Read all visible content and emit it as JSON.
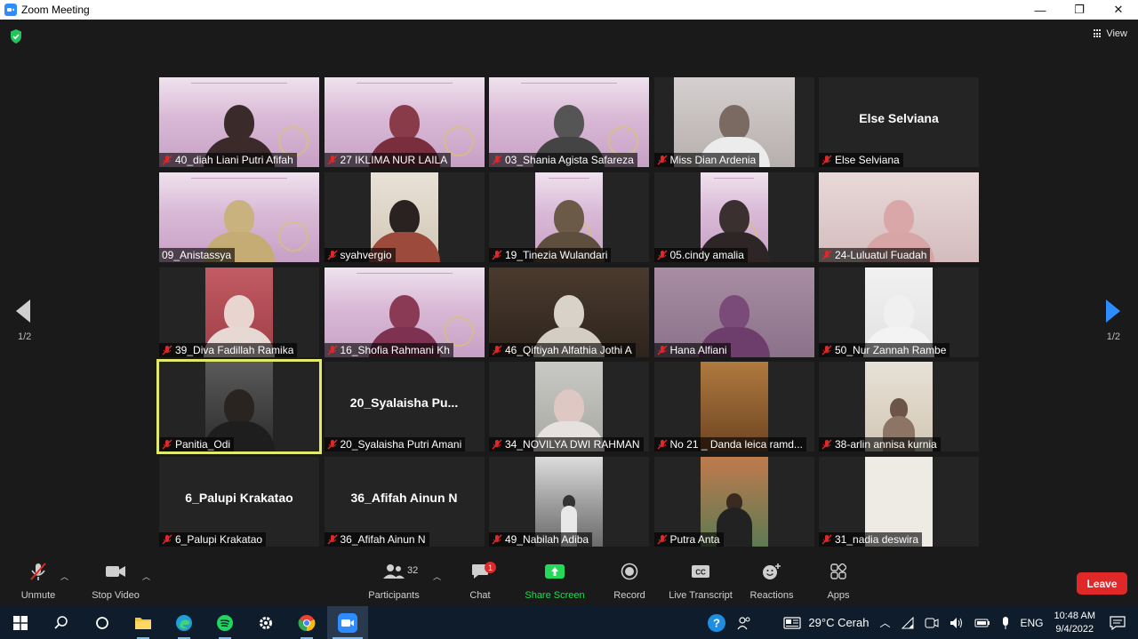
{
  "window": {
    "title": "Zoom Meeting",
    "minimize": "—",
    "restore": "❐",
    "close": "✕"
  },
  "meeting": {
    "view_label": "View",
    "page_indicator_left": "1/2",
    "page_indicator_right": "1/2",
    "participants": [
      {
        "name": "40_diah Liani Putri Afifah",
        "video": true
      },
      {
        "name": "27 IKLIMA NUR LAILA",
        "video": true
      },
      {
        "name": "03_Shania Agista Safareza",
        "video": true
      },
      {
        "name": "Miss Dian Ardenia",
        "video": true
      },
      {
        "name": "Else Selviana",
        "video": false,
        "display_name": "Else Selviana"
      },
      {
        "name": "09_Anistassya",
        "video": true
      },
      {
        "name": "syahvergio",
        "video": true
      },
      {
        "name": "19_Tinezia Wulandari",
        "video": true
      },
      {
        "name": "05.cindy amalia",
        "video": true
      },
      {
        "name": "24-Luluatul Fuadah",
        "video": true
      },
      {
        "name": "39_Diva Fadillah Ramika",
        "video": true
      },
      {
        "name": "16_Shofia Rahmani Kh",
        "video": true
      },
      {
        "name": "46_Qiftiyah Alfathia Jothi A",
        "video": true
      },
      {
        "name": "Hana Alfiani",
        "video": true
      },
      {
        "name": "50_Nur Zannah Rambe",
        "video": true
      },
      {
        "name": "Panitia_Odi",
        "video": true,
        "active_speaker": true
      },
      {
        "name": "20_Syalaisha Putri Amani",
        "video": false,
        "display_name": "20_Syalaisha  Pu..."
      },
      {
        "name": "34_NOVILYA DWI RAHMAN",
        "video": true
      },
      {
        "name": "No 21 _ Danda leica ramd...",
        "video": true
      },
      {
        "name": "38-arlin annisa kurnia",
        "video": true
      },
      {
        "name": "6_Palupi Krakatao",
        "video": false,
        "display_name": "6_Palupi Krakatao"
      },
      {
        "name": "36_Afifah Ainun N",
        "video": false,
        "display_name": "36_Afifah Ainun N"
      },
      {
        "name": "49_Nabilah Adiba",
        "video": true
      },
      {
        "name": "Putra Anta",
        "video": true
      },
      {
        "name": "31_nadia deswira",
        "video": true
      }
    ]
  },
  "toolbar": {
    "unmute": "Unmute",
    "stop_video": "Stop Video",
    "participants": "Participants",
    "participant_count": "32",
    "chat": "Chat",
    "chat_badge": "1",
    "share_screen": "Share Screen",
    "record": "Record",
    "live_transcript": "Live Transcript",
    "reactions": "Reactions",
    "apps": "Apps",
    "leave": "Leave",
    "cc_text": "CC"
  },
  "taskbar": {
    "weather": "29°C  Cerah",
    "language": "ENG",
    "time": "10:48 AM",
    "date": "9/4/2022"
  },
  "colors": {
    "active_speaker": "#e2ea6c",
    "leave": "#e02828",
    "share_green": "#23d959",
    "zoom_blue": "#2d8cff"
  }
}
